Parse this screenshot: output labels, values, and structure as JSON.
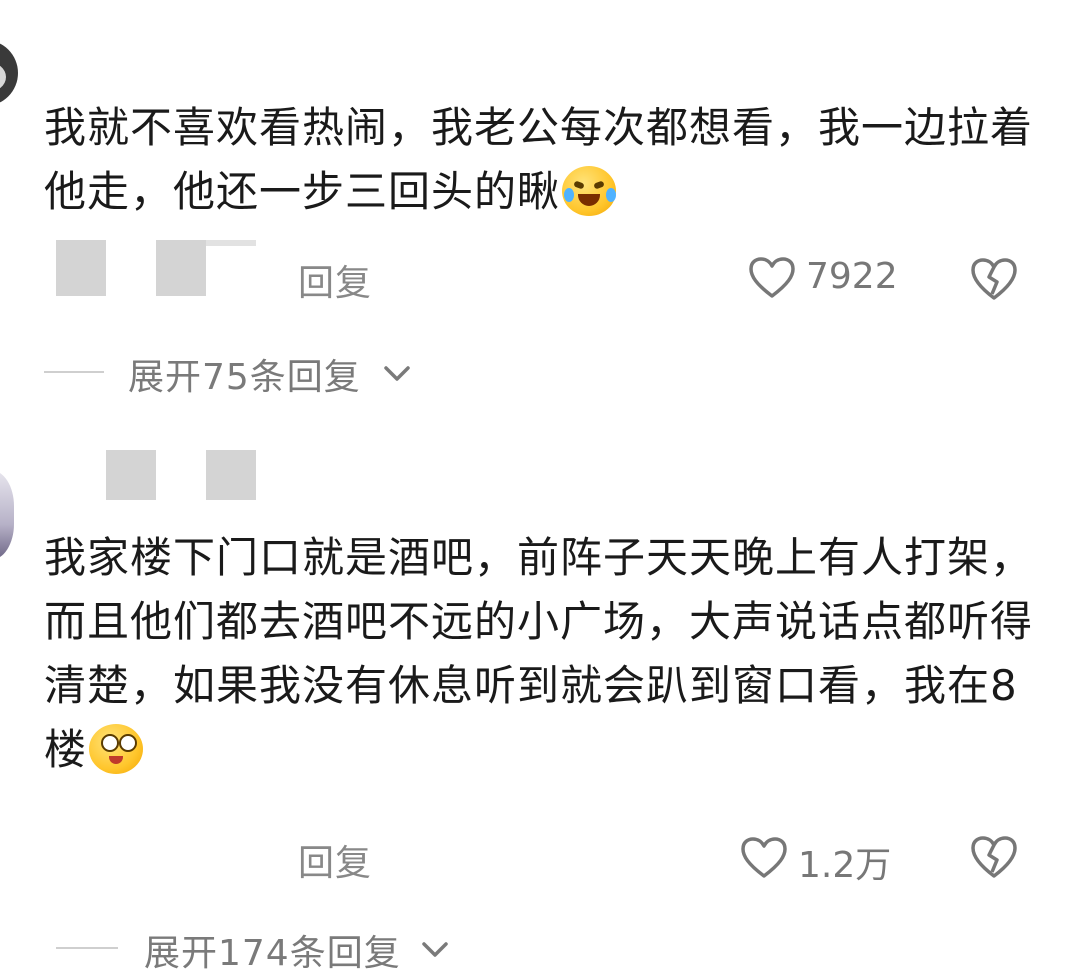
{
  "comments": [
    {
      "text": "我就不喜欢看热闹，我老公每次都想看，我一边拉着他走，他还一步三回头的瞅",
      "emoji": "laughing-crying-emoji",
      "reply_label": "回复",
      "likes": "7922",
      "expand_label": "展开75条回复"
    },
    {
      "text": "我家楼下门口就是酒吧，前阵子天天晚上有人打架，而且他们都去酒吧不远的小广场，大声说话点都听得清楚，如果我没有休息听到就会趴到窗口看，我在8楼",
      "emoji": "teary-eyed-emoji",
      "reply_label": "回复",
      "likes": "1.2万",
      "expand_label": "展开174条回复"
    }
  ],
  "icons": {
    "like": "heart-outline-icon",
    "dislike": "broken-heart-icon",
    "expand": "chevron-down-icon"
  },
  "colors": {
    "text": "#1a1a1a",
    "muted": "#888888",
    "blur": "#d4d4d4"
  }
}
